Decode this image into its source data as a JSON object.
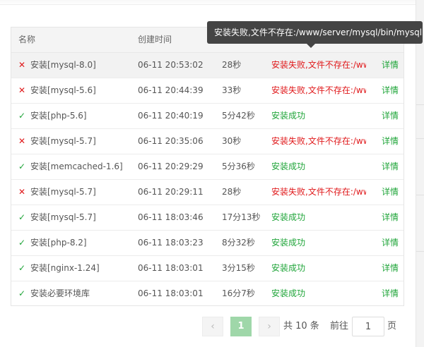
{
  "columns": {
    "name": "名称",
    "created": "创建时间",
    "duration": "",
    "result": "",
    "action": ""
  },
  "tooltip": {
    "text": "安装失败,文件不存在:/www/server/mysql/bin/mysql"
  },
  "rows": [
    {
      "status": "fail",
      "name": "安装[mysql-8.0]",
      "time": "06-11 20:53:02",
      "duration": "28秒",
      "result": "安装失败,文件不存在:/www/server/mysql/bin/mysql",
      "action": "详情"
    },
    {
      "status": "fail",
      "name": "安装[mysql-5.6]",
      "time": "06-11 20:44:39",
      "duration": "33秒",
      "result": "安装失败,文件不存在:/www/server/mysql/bin/mysql",
      "action": "详情"
    },
    {
      "status": "ok",
      "name": "安装[php-5.6]",
      "time": "06-11 20:40:19",
      "duration": "5分42秒",
      "result": "安装成功",
      "action": "详情"
    },
    {
      "status": "fail",
      "name": "安装[mysql-5.7]",
      "time": "06-11 20:35:06",
      "duration": "30秒",
      "result": "安装失败,文件不存在:/www/server/mysql/bin/mysql",
      "action": "详情"
    },
    {
      "status": "ok",
      "name": "安装[memcached-1.6]",
      "time": "06-11 20:29:29",
      "duration": "5分36秒",
      "result": "安装成功",
      "action": "详情"
    },
    {
      "status": "fail",
      "name": "安装[mysql-5.7]",
      "time": "06-11 20:29:11",
      "duration": "28秒",
      "result": "安装失败,文件不存在:/www/server/mysql/bin/mysql",
      "action": "详情"
    },
    {
      "status": "ok",
      "name": "安装[mysql-5.7]",
      "time": "06-11 18:03:46",
      "duration": "17分13秒",
      "result": "安装成功",
      "action": "详情"
    },
    {
      "status": "ok",
      "name": "安装[php-8.2]",
      "time": "06-11 18:03:23",
      "duration": "8分32秒",
      "result": "安装成功",
      "action": "详情"
    },
    {
      "status": "ok",
      "name": "安装[nginx-1.24]",
      "time": "06-11 18:03:01",
      "duration": "3分15秒",
      "result": "安装成功",
      "action": "详情"
    },
    {
      "status": "ok",
      "name": "安装必要环境库",
      "time": "06-11 18:03:01",
      "duration": "16分7秒",
      "result": "安装成功",
      "action": "详情"
    }
  ],
  "pagination": {
    "prev_icon": "chevron-left",
    "current_page": "1",
    "next_icon": "chevron-right",
    "total_text": "共 10 条",
    "goto_prefix": "前往",
    "goto_value": "1",
    "goto_suffix": "页"
  },
  "colors": {
    "success": "#20a53a",
    "failure": "#e0191b",
    "tooltip_bg": "#444444",
    "current_page_bg": "#9fd7a9"
  }
}
